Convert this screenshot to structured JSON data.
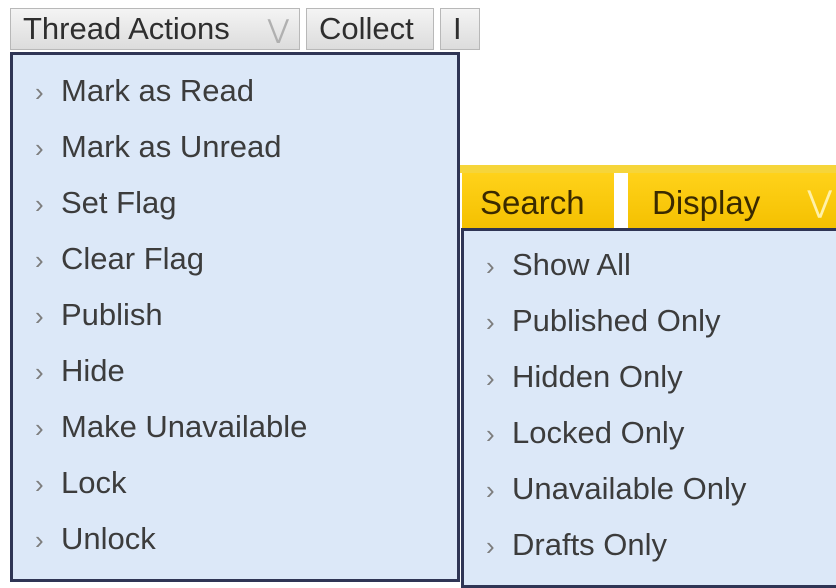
{
  "toolbar": {
    "thread_actions_label": "Thread Actions",
    "collect_label": "Collect",
    "next_partial_label": "I"
  },
  "yellow_toolbar": {
    "search_label": "Search",
    "display_label": "Display"
  },
  "icons": {
    "chevron": "double-chevron-down",
    "arrow": "›"
  },
  "thread_menu": {
    "items": [
      {
        "label": "Mark as Read"
      },
      {
        "label": "Mark as Unread"
      },
      {
        "label": "Set Flag"
      },
      {
        "label": "Clear Flag"
      },
      {
        "label": "Publish"
      },
      {
        "label": "Hide"
      },
      {
        "label": "Make Unavailable"
      },
      {
        "label": "Lock"
      },
      {
        "label": "Unlock"
      }
    ]
  },
  "display_menu": {
    "items": [
      {
        "label": "Show All"
      },
      {
        "label": "Published Only"
      },
      {
        "label": "Hidden Only"
      },
      {
        "label": "Locked Only"
      },
      {
        "label": "Unavailable Only"
      },
      {
        "label": "Drafts Only"
      }
    ]
  },
  "colors": {
    "menu_bg": "#dce8f8",
    "menu_border": "#2f3555",
    "yellow": "#f4c000"
  }
}
